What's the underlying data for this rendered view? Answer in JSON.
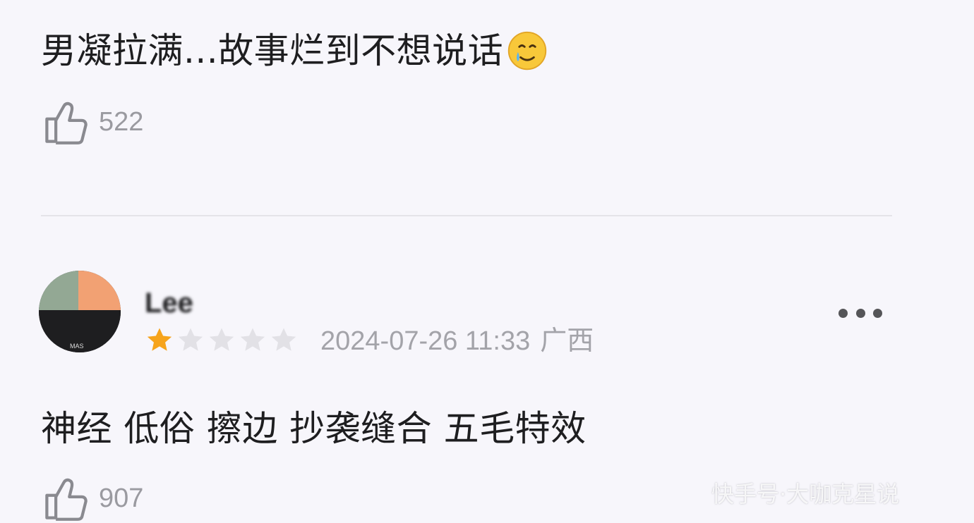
{
  "comment_1": {
    "text": "男凝拉满...故事烂到不想说话",
    "emoji": "holding-back-tears-emoji",
    "like_count": "522",
    "like_icon": "thumbs-up-icon"
  },
  "comment_2": {
    "username": "Lee",
    "rating": 1,
    "rating_max": 5,
    "date": "2024-07-26 11:33",
    "region": "广西",
    "more_icon": "more-dots-icon",
    "text": "神经 低俗 擦边 抄袭缝合 五毛特效",
    "like_count": "907",
    "like_icon": "thumbs-up-icon"
  },
  "colors": {
    "background": "#f7f6fb",
    "star_filled": "#f6a41c",
    "star_empty": "#e2e1e6",
    "meta_text": "#a3a3a9"
  },
  "watermark": "快手号·大咖克星说"
}
